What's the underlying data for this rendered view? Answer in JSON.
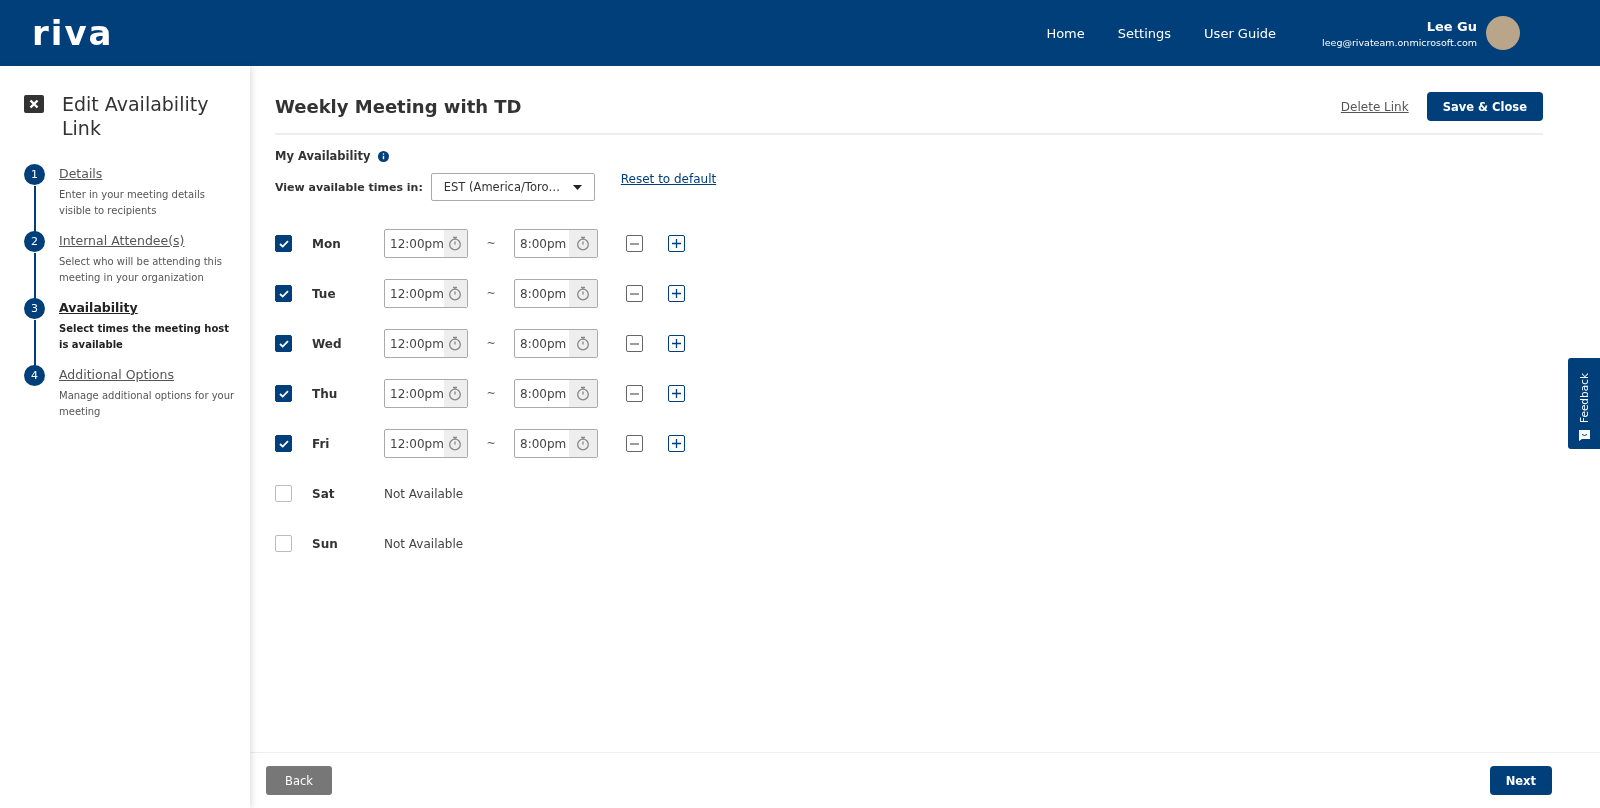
{
  "header": {
    "logo": "riva",
    "nav": [
      "Home",
      "Settings",
      "User Guide"
    ],
    "user": {
      "name": "Lee Gu",
      "email": "leeg@rivateam.onmicrosoft.com"
    }
  },
  "sidebar": {
    "title": "Edit Availability Link",
    "steps": [
      {
        "number": "1",
        "title": "Details",
        "description": "Enter in your meeting details visible to recipients",
        "selected": false
      },
      {
        "number": "2",
        "title": "Internal Attendee(s)",
        "description": "Select who will be attending this meeting in your organization",
        "selected": false
      },
      {
        "number": "3",
        "title": "Availability",
        "description": "Select times the meeting host is available",
        "selected": true
      },
      {
        "number": "4",
        "title": "Additional Options",
        "description": "Manage additional options for your meeting",
        "selected": false
      }
    ]
  },
  "main": {
    "title": "Weekly Meeting with TD",
    "delete_link": "Delete Link",
    "save_button": "Save & Close",
    "section_label": "My Availability",
    "timezone_label": "View available times in:",
    "timezone_value": "EST (America/Toro…",
    "reset_link": "Reset to default",
    "days": [
      {
        "name": "Mon",
        "checked": true,
        "start": "12:00pm",
        "separator": "~",
        "end": "8:00pm"
      },
      {
        "name": "Tue",
        "checked": true,
        "start": "12:00pm",
        "separator": "~",
        "end": "8:00pm"
      },
      {
        "name": "Wed",
        "checked": true,
        "start": "12:00pm",
        "separator": "~",
        "end": "8:00pm"
      },
      {
        "name": "Thu",
        "checked": true,
        "start": "12:00pm",
        "separator": "~",
        "end": "8:00pm"
      },
      {
        "name": "Fri",
        "checked": true,
        "start": "12:00pm",
        "separator": "~",
        "end": "8:00pm"
      },
      {
        "name": "Sat",
        "checked": false,
        "note": "Not Available"
      },
      {
        "name": "Sun",
        "checked": false,
        "note": "Not Available"
      }
    ]
  },
  "footer": {
    "back": "Back",
    "next": "Next"
  },
  "feedback": "Feedback"
}
